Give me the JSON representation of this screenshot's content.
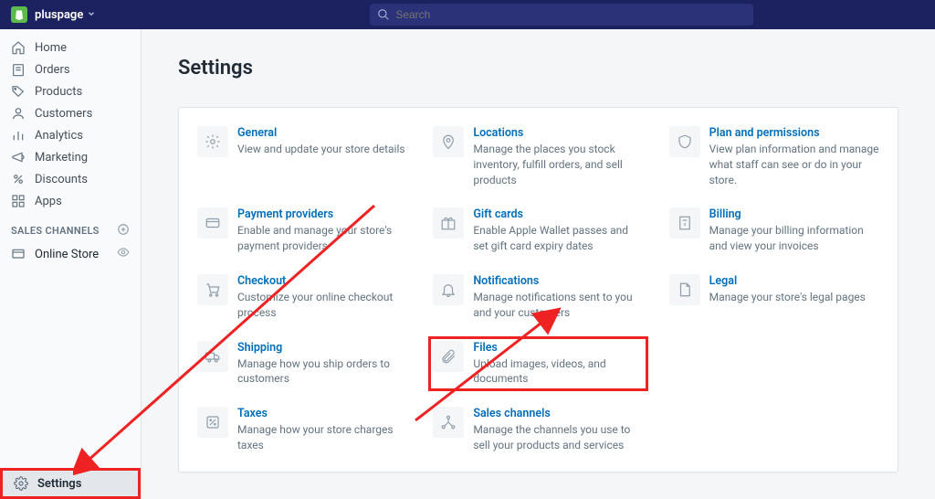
{
  "header": {
    "store_name": "pluspage",
    "search_placeholder": "Search"
  },
  "sidebar": {
    "items": [
      {
        "label": "Home"
      },
      {
        "label": "Orders"
      },
      {
        "label": "Products"
      },
      {
        "label": "Customers"
      },
      {
        "label": "Analytics"
      },
      {
        "label": "Marketing"
      },
      {
        "label": "Discounts"
      },
      {
        "label": "Apps"
      }
    ],
    "channels_header": "SALES CHANNELS",
    "online_store": "Online Store",
    "settings": "Settings"
  },
  "page": {
    "title": "Settings"
  },
  "tiles": [
    {
      "title": "General",
      "desc": "View and update your store details"
    },
    {
      "title": "Locations",
      "desc": "Manage the places you stock inventory, fulfill orders, and sell products"
    },
    {
      "title": "Plan and permissions",
      "desc": "View plan information and manage what staff can see or do in your store."
    },
    {
      "title": "Payment providers",
      "desc": "Enable and manage your store's payment providers"
    },
    {
      "title": "Gift cards",
      "desc": "Enable Apple Wallet passes and set gift card expiry dates"
    },
    {
      "title": "Billing",
      "desc": "Manage your billing information and view your invoices"
    },
    {
      "title": "Checkout",
      "desc": "Customize your online checkout process"
    },
    {
      "title": "Notifications",
      "desc": "Manage notifications sent to you and your customers"
    },
    {
      "title": "Legal",
      "desc": "Manage your store's legal pages"
    },
    {
      "title": "Shipping",
      "desc": "Manage how you ship orders to customers"
    },
    {
      "title": "Files",
      "desc": "Upload images, videos, and documents"
    },
    {
      "title": "Taxes",
      "desc": "Manage how your store charges taxes"
    },
    {
      "title": "Sales channels",
      "desc": "Manage the channels you use to sell your products and services"
    }
  ]
}
